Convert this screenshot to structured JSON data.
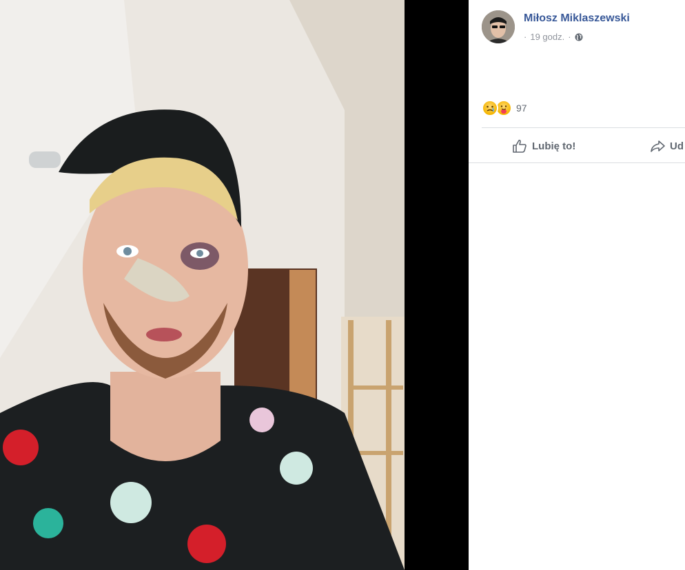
{
  "post": {
    "author": "Miłosz Miklaszewski",
    "time": "19 godz.",
    "separator": "·",
    "privacy_icon": "globe-icon",
    "reaction_count": "97",
    "reaction_icons": [
      "sad-reaction-icon",
      "care-reaction-icon"
    ]
  },
  "actions": {
    "like_label": "Lubię to!",
    "share_label": "Ud"
  }
}
